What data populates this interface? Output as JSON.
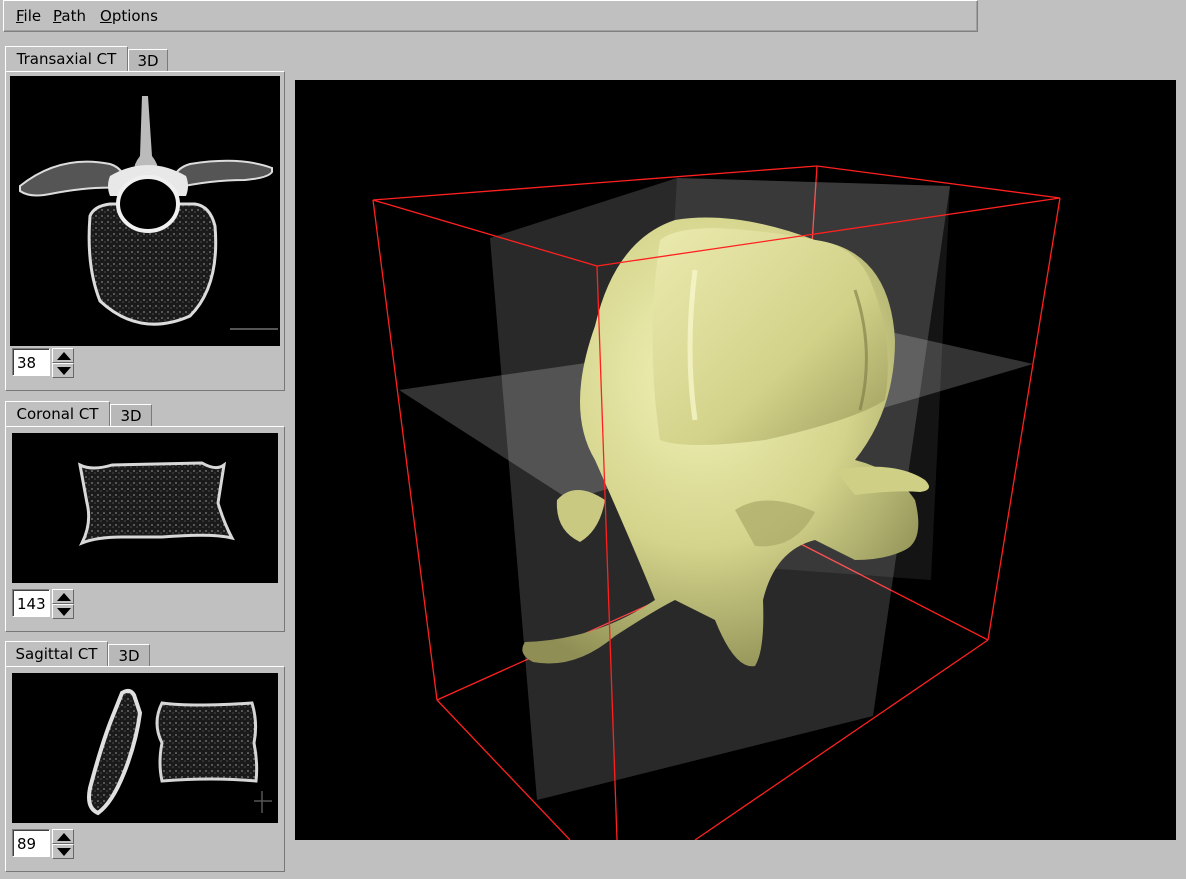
{
  "menu": {
    "file": {
      "underline": "F",
      "rest": "ile"
    },
    "path": {
      "underline": "P",
      "rest": "ath"
    },
    "options": {
      "underline": "O",
      "rest": "ptions"
    }
  },
  "panels": [
    {
      "tab_label": "Transaxial CT",
      "tab_3d": "3D",
      "slice": "38"
    },
    {
      "tab_label": "Coronal CT",
      "tab_3d": "3D",
      "slice": "143"
    },
    {
      "tab_label": "Sagittal CT",
      "tab_3d": "3D",
      "slice": "89"
    }
  ],
  "colors": {
    "bounding_box": "#ff2020",
    "bone": "#d8d890",
    "background": "#000000",
    "window": "#c0c0c0"
  }
}
